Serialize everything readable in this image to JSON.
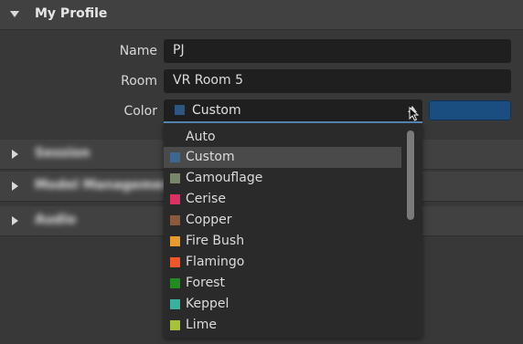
{
  "profile": {
    "title": "My Profile"
  },
  "form": {
    "name_label": "Name",
    "name_value": "PJ",
    "room_label": "Room",
    "room_value": "VR Room 5",
    "color_label": "Color",
    "color_value": "Custom",
    "selected_swatch": "#2c5783",
    "preview_color": "#1a4d80"
  },
  "sections": [
    "Session",
    "Model Management",
    "Audio"
  ],
  "dropdown": {
    "options": [
      {
        "label": "Auto",
        "color": null
      },
      {
        "label": "Custom",
        "color": "#3d6690"
      },
      {
        "label": "Camouflage",
        "color": "#78866b"
      },
      {
        "label": "Cerise",
        "color": "#de3163"
      },
      {
        "label": "Copper",
        "color": "#8b5a3c"
      },
      {
        "label": "Fire Bush",
        "color": "#e89a2e"
      },
      {
        "label": "Flamingo",
        "color": "#f2552c"
      },
      {
        "label": "Forest",
        "color": "#228b22"
      },
      {
        "label": "Keppel",
        "color": "#3ab09e"
      },
      {
        "label": "Lime",
        "color": "#a8c13a"
      }
    ],
    "selected_index": 1
  }
}
